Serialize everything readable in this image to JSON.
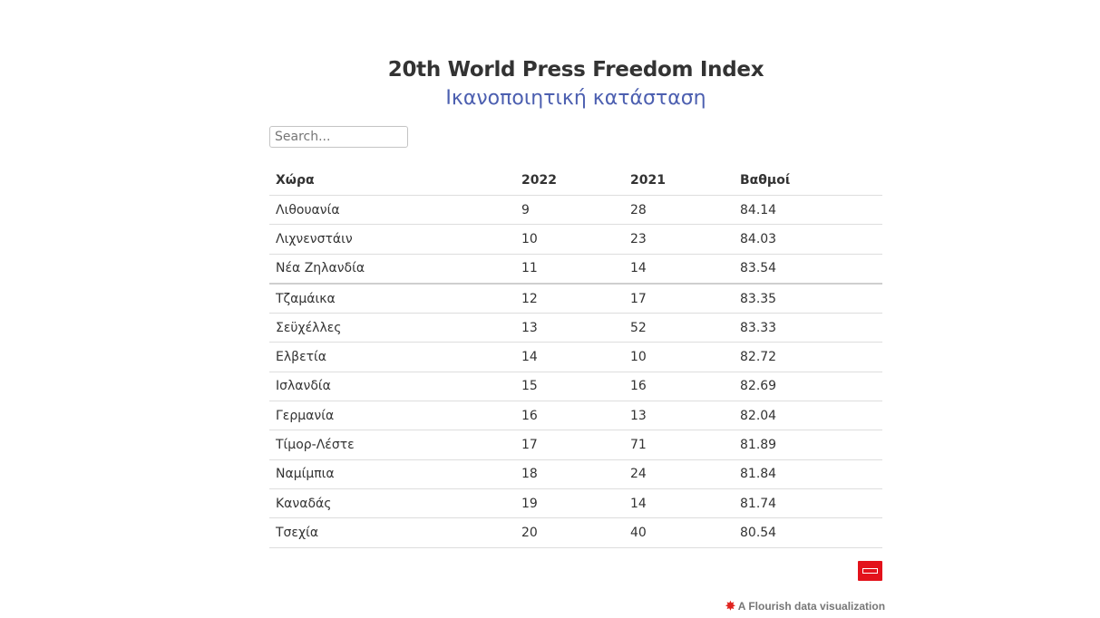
{
  "header": {
    "title": "20th World Press Freedom Index",
    "subtitle": "Ικανοποιητική κατάσταση"
  },
  "search": {
    "placeholder": "Search..."
  },
  "table": {
    "columns": [
      "Χώρα",
      "2022",
      "2021",
      "Βαθμοί"
    ],
    "rows": [
      [
        "Λιθουανία",
        "9",
        "28",
        "84.14"
      ],
      [
        "Λιχνενστάιν",
        "10",
        "23",
        "84.03"
      ],
      [
        "Νέα Ζηλανδία",
        "11",
        "14",
        "83.54"
      ],
      [
        "Τζαμάικα",
        "12",
        "17",
        "83.35"
      ],
      [
        "Σεϋχέλλες",
        "13",
        "52",
        "83.33"
      ],
      [
        "Ελβετία",
        "14",
        "10",
        "82.72"
      ],
      [
        "Ισλανδία",
        "15",
        "16",
        "82.69"
      ],
      [
        "Γερμανία",
        "16",
        "13",
        "82.04"
      ],
      [
        "Τίμορ-Λέστε",
        "17",
        "71",
        "81.89"
      ],
      [
        "Ναμίμπια",
        "18",
        "24",
        "81.84"
      ],
      [
        "Καναδάς",
        "19",
        "14",
        "81.74"
      ],
      [
        "Τσεχία",
        "20",
        "40",
        "80.54"
      ]
    ]
  },
  "footer": {
    "badge_icon": "news-logo-icon",
    "badge_color": "#e3121b",
    "flourish_label": "A Flourish data visualization",
    "flourish_icon": "flourish-star-icon"
  }
}
